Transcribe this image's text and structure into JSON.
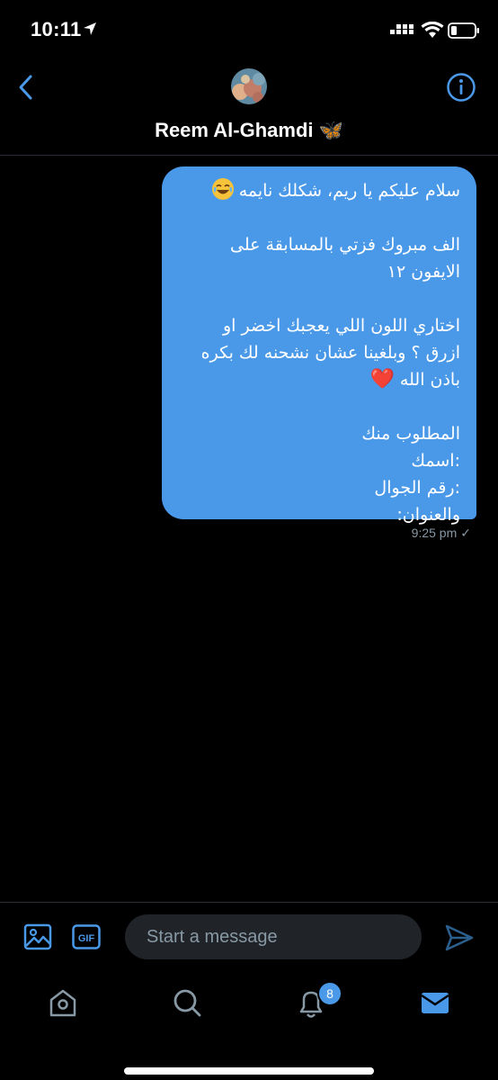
{
  "status_bar": {
    "time": "10:11",
    "icons": [
      "location-arrow-icon",
      "signal-icon",
      "wifi-icon",
      "battery-icon"
    ]
  },
  "header": {
    "contact_name": "Reem Al-Ghamdi",
    "name_emoji": "🦋",
    "back_icon": "chevron-left-icon",
    "info_icon": "info-icon"
  },
  "conversation": {
    "message": {
      "line1": "سلام عليكم يا ريم، شكلك نايمه",
      "line1_emoji": "laughing-emoji",
      "line2": "الف مبروك فزتي بالمسابقة على",
      "line3": "الايفون ١٢",
      "line4": "اختاري اللون اللي يعجبك اخضر او",
      "line5": "ازرق ؟ وبلغينا عشان نشحنه لك بكره",
      "line6": "باذن الله",
      "line6_emoji": "❤️",
      "line7": "المطلوب منك",
      "line8": ":اسمك",
      "line9": ":رقم الجوال",
      "line10": "والعنوان:",
      "time": "9:25 pm",
      "status_icon": "✓"
    }
  },
  "composer": {
    "placeholder": "Start a message",
    "gif_label": "GIF",
    "media_icon": "image-icon",
    "send_icon": "send-icon"
  },
  "tabbar": {
    "tabs": [
      "home",
      "search",
      "notifications",
      "messages"
    ],
    "notification_count": "8"
  },
  "colors": {
    "accent": "#4a99e9",
    "background": "#000000",
    "bubble": "#4a99e9",
    "muted": "#8899a6"
  }
}
